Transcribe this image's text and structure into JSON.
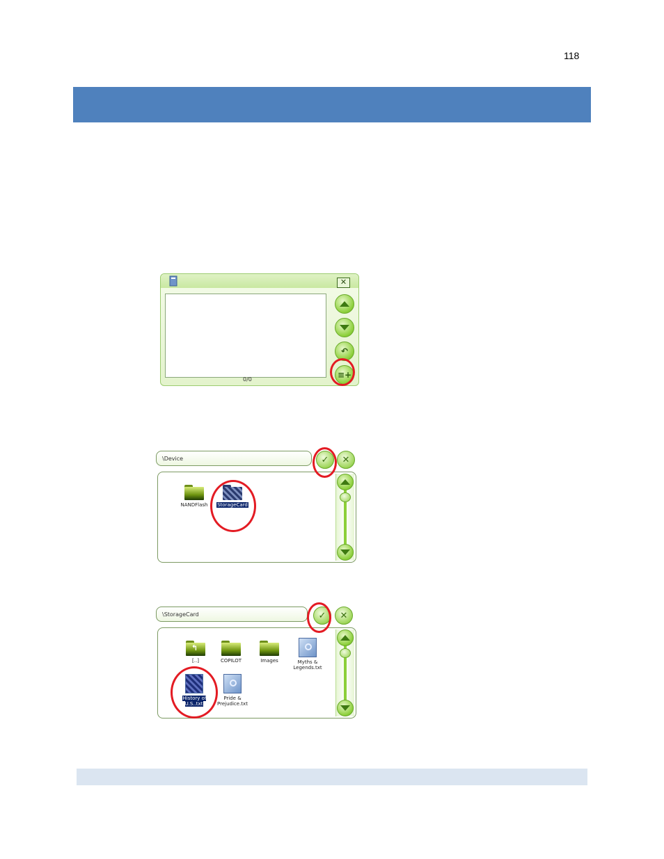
{
  "page": {
    "number": "118"
  },
  "colors": {
    "header_bar": "#4f81bd",
    "footer_bar": "#dbe5f1",
    "highlight_circle": "#e31b23"
  },
  "playlist_dialog": {
    "counter": "0/0",
    "buttons": [
      "up-arrow-icon",
      "down-arrow-icon",
      "back-arrow-icon",
      "add-list-icon"
    ],
    "add_glyph": "≡+",
    "close_glyph": "✕"
  },
  "browser_device": {
    "path": "\\Device",
    "items": [
      {
        "label": "NANDFlash",
        "type": "folder",
        "selected": false
      },
      {
        "label": "StorageCard",
        "type": "folder",
        "selected": true
      }
    ]
  },
  "browser_storage": {
    "path": "\\StorageCard",
    "items": [
      {
        "label": "[..]",
        "type": "up-folder",
        "selected": false
      },
      {
        "label": "COPILOT",
        "type": "folder",
        "selected": false
      },
      {
        "label": "Images",
        "type": "folder",
        "selected": false
      },
      {
        "label": "Myths & Legends.txt",
        "type": "file",
        "selected": false
      },
      {
        "label": "History of U.S..txt",
        "type": "file",
        "selected": true
      },
      {
        "label": "Pride & Prejudice.txt",
        "type": "file",
        "selected": false
      }
    ]
  },
  "glyphs": {
    "ok": "✓",
    "cancel": "✕",
    "back": "↶",
    "up_folder": "↰"
  }
}
